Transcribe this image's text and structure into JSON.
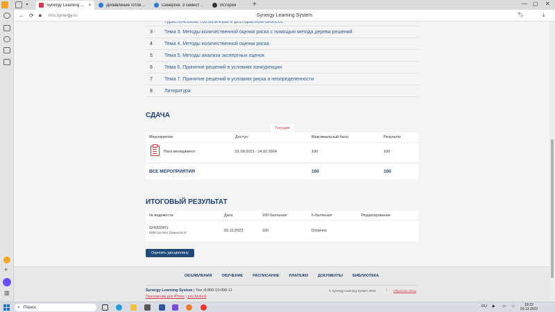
{
  "browser": {
    "tabs": [
      {
        "label": "Synergy Learning System",
        "active": true
      },
      {
        "label": "Добавление готовой раб",
        "active": false
      },
      {
        "label": "Синергия. 3 семестр. Инс",
        "active": false
      },
      {
        "label": "История",
        "active": false
      }
    ],
    "url": "lms.synergy.ru",
    "page_title": "Synergy Learning System"
  },
  "topics": {
    "cut_text": "туристическом, гостиничном и ресторанном бизнесе",
    "items": [
      {
        "num": "3",
        "title": "Тема 3. Методы количественной оценки риска с помощью метода дерева решений"
      },
      {
        "num": "4",
        "title": "Тема 4. Методы количественной оценки риска"
      },
      {
        "num": "5",
        "title": "Тема 5. Методы анализа экспертных оценок"
      },
      {
        "num": "6",
        "title": "Тема 6. Принятие решений в условиях конкуренции"
      },
      {
        "num": "7",
        "title": "Тема 7. Принятие решений в условиях риска и неопределенности"
      },
      {
        "num": "8",
        "title": "Литература"
      }
    ]
  },
  "sdacha": {
    "heading": "СДАЧА",
    "tab_current": "Текущие",
    "columns": {
      "event": "Мероприятие",
      "access": "Доступ",
      "max": "Максимальный балл",
      "result": "Результат"
    },
    "row": {
      "event": "Риск-менеджмент",
      "access": "01.09.2023 - 14.02.2024",
      "max": "100",
      "result": "100"
    },
    "total": {
      "label": "ВСЕ МЕРОПРИЯТИЯ",
      "max": "100",
      "result": "100"
    }
  },
  "itog": {
    "heading": "ИТОГОВЫЙ РЕЗУЛЬТАТ",
    "columns": {
      "vedomost": "№ ведомости",
      "date": "Дата",
      "b100": "100-балльная",
      "b5": "5-балльная",
      "edit": "Редактирование"
    },
    "row": {
      "vedomost": "024202951",
      "vedomost_sub": "КИМ (on-line) (Закрыта) И",
      "date": "03.12.2023",
      "b100": "100",
      "b5": "Отлично",
      "edit": ""
    },
    "button": "Оценить дисциплину"
  },
  "footer": {
    "nav": [
      "ОБЪЯВЛЕНИЯ",
      "ОБУЧЕНИЕ",
      "РАСПИСАНИЕ",
      "ПЛАТЕЖИ",
      "ДОКУМЕНТЫ",
      "БИБЛИОТЕКА"
    ],
    "brand": "Synergy Learning System",
    "phone": "Тел.:8-800-10-000-11",
    "app_iphone": "Приложение для iPhone",
    "app_android": "для Android",
    "copyright": "© Synergy Learning System 2023",
    "feedback": "Обратная связь"
  },
  "taskbar": {
    "search_placeholder": "Поиск",
    "lang": "RU",
    "time": "18:22",
    "date": "03.12.2023"
  },
  "colors": {
    "accent": "#1d3e6e",
    "link": "#2d5c8f",
    "red": "#d23c50",
    "button": "#1f4a7a"
  }
}
